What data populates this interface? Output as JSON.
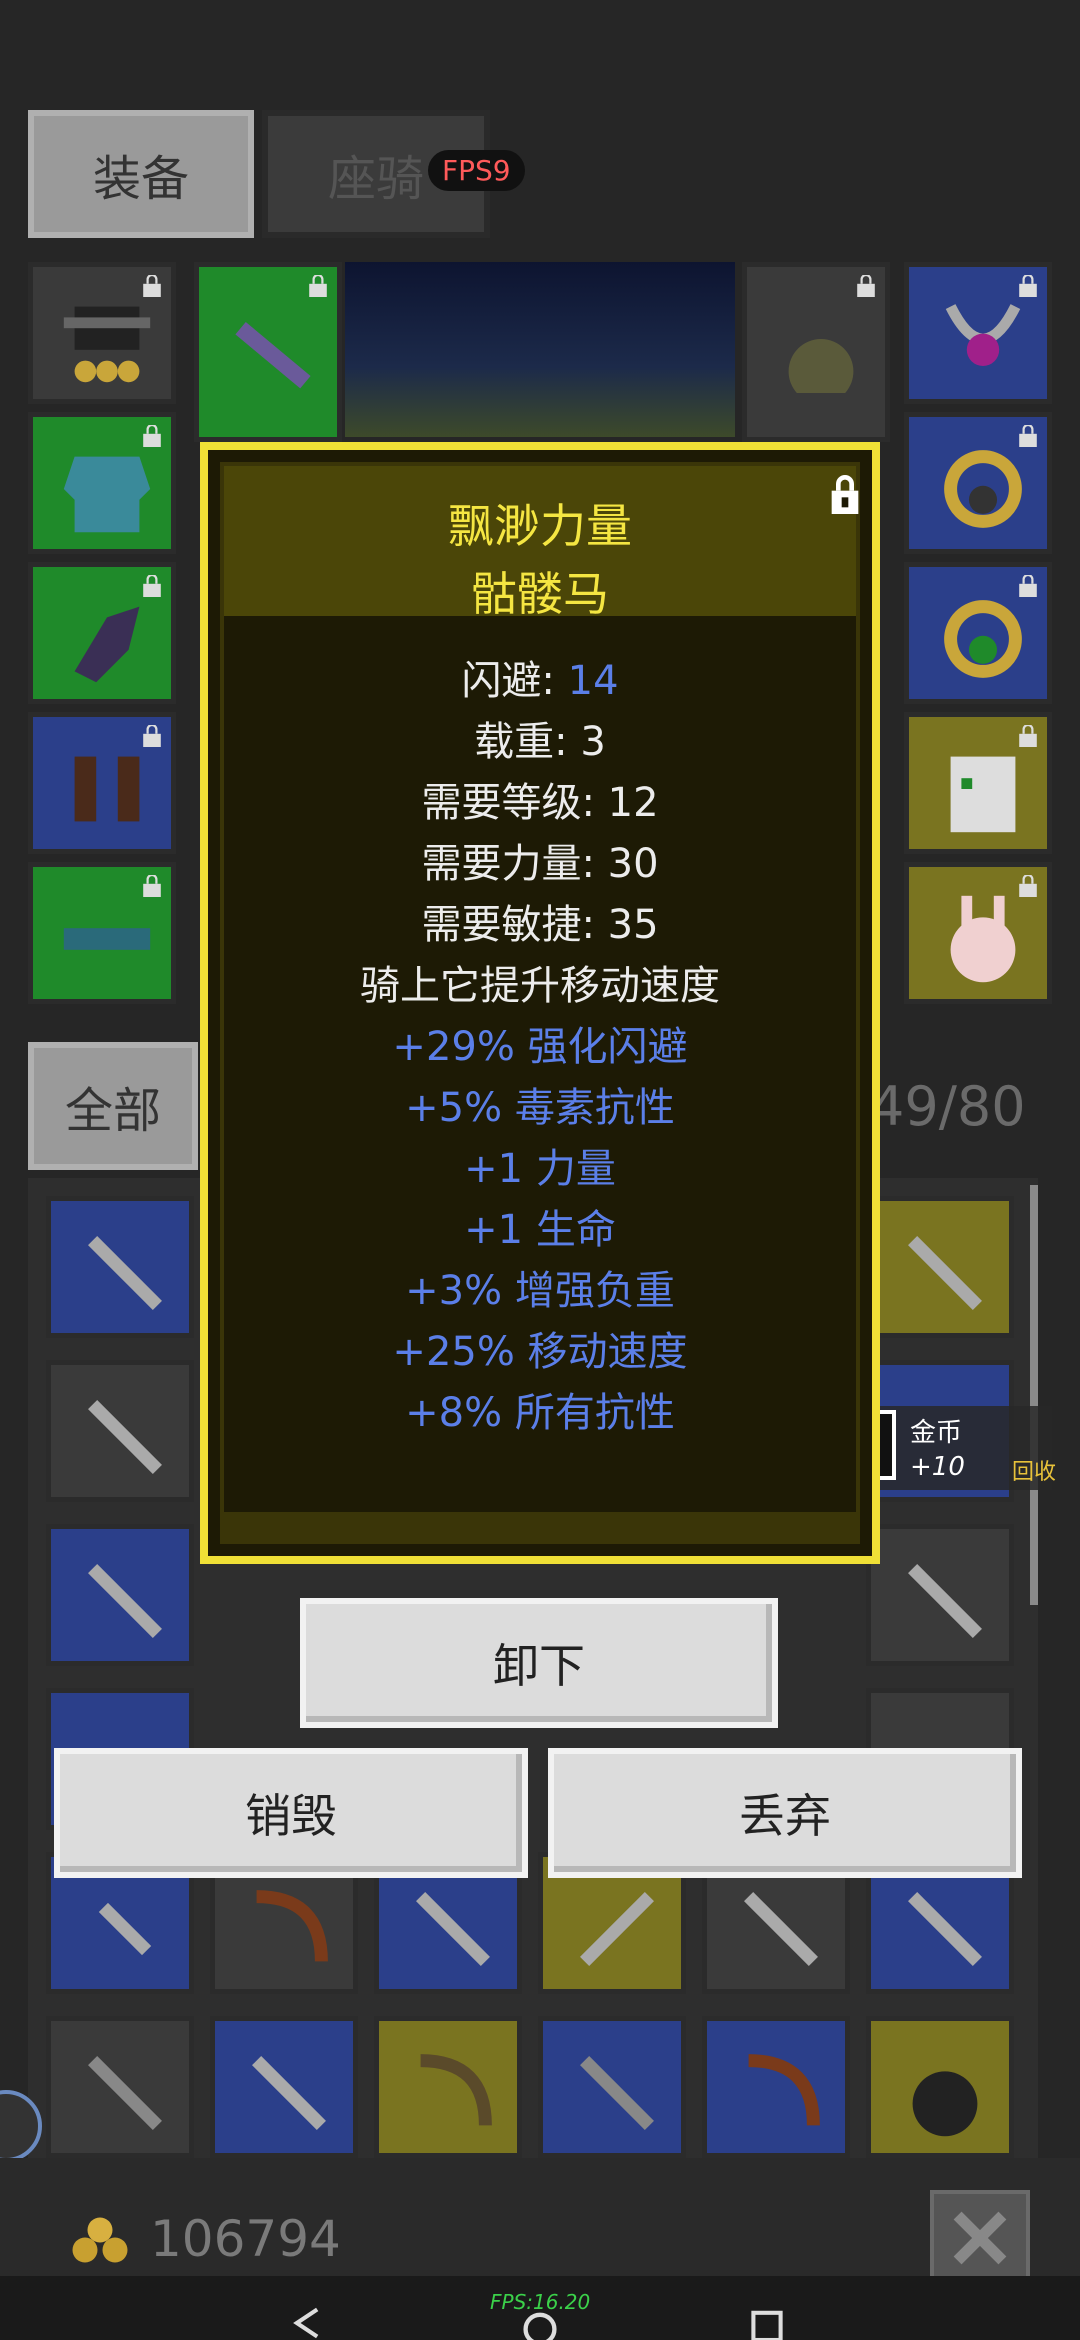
{
  "tabs": {
    "equipment": "装备",
    "mount": "座骑"
  },
  "fps_badge": "FPS9",
  "popup": {
    "title": "飘渺力量",
    "subtitle": "骷髅马",
    "dodge_label": "闪避: ",
    "dodge_value": "14",
    "weight": "载重: 3",
    "req_level": "需要等级: 12",
    "req_str": "需要力量: 30",
    "req_agi": "需要敏捷: 35",
    "mount_desc": "骑上它提升移动速度",
    "mods": [
      "+29% 强化闪避",
      "+5% 毒素抗性",
      "+1 力量",
      "+1 生命",
      "+3% 增强负重",
      "+25% 移动速度",
      "+8% 所有抗性"
    ]
  },
  "filter_tab": "全部",
  "inventory_count": "49/80",
  "coin_notice": {
    "label": "金币",
    "amount": "+10",
    "recycle": "回收"
  },
  "buttons": {
    "unequip": "卸下",
    "destroy": "销毁",
    "drop": "丢弃"
  },
  "gold": "106794",
  "system_fps": "FPS:16.20",
  "colors": {
    "accent_yellow": "#f5e642",
    "stat_blue": "#5b7fe8",
    "popup_border": "#f0e036"
  }
}
